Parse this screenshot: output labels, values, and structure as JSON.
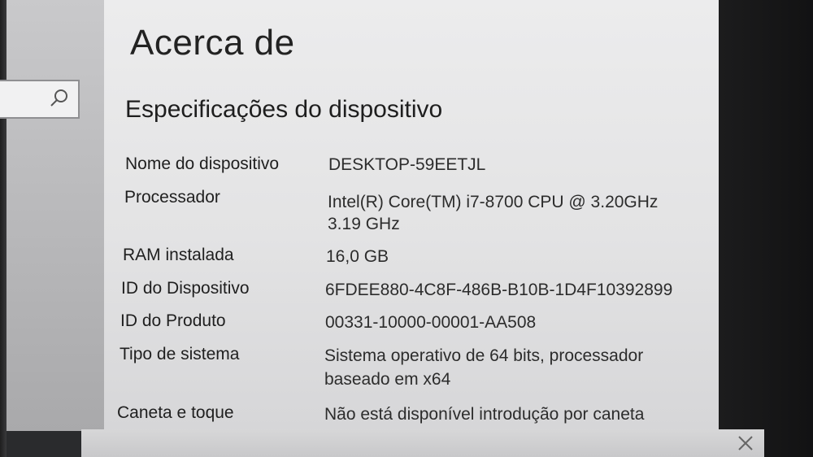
{
  "page": {
    "title": "Acerca de",
    "section_title": "Especificações do dispositivo"
  },
  "specs": [
    {
      "label": "Nome do dispositivo",
      "value_lines": [
        "DESKTOP-59EETJL"
      ]
    },
    {
      "label": "Processador",
      "value_lines": [
        "Intel(R) Core(TM) i7-8700 CPU @ 3.20GHz",
        "3.19 GHz"
      ]
    },
    {
      "label": "RAM instalada",
      "value_lines": [
        "16,0 GB"
      ]
    },
    {
      "label": "ID do Dispositivo",
      "value_lines": [
        "6FDEE880-4C8F-486B-B10B-1D4F10392899"
      ]
    },
    {
      "label": "ID do Produto",
      "value_lines": [
        "00331-10000-00001-AA508"
      ]
    },
    {
      "label": "Tipo de sistema",
      "value_lines": [
        "Sistema operativo de 64 bits, processador",
        "baseado em x64"
      ]
    },
    {
      "label": "Caneta e toque",
      "value_lines": [
        "Não está disponível introdução por caneta"
      ]
    }
  ],
  "icons": {
    "search": "search-icon",
    "close": "close-icon"
  }
}
